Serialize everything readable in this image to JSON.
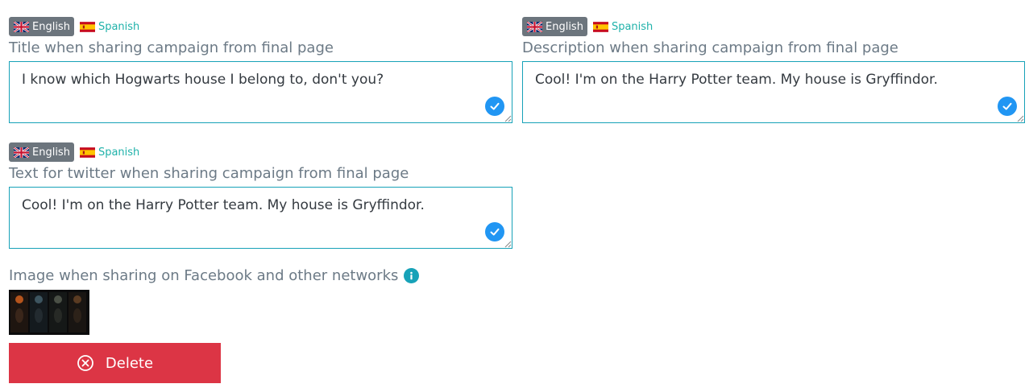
{
  "fields": [
    {
      "lang_active": "English",
      "lang_inactive": "Spanish",
      "label": "Title when sharing campaign from final page",
      "value": "I know which Hogwarts house I belong to, don't you?"
    },
    {
      "lang_active": "English",
      "lang_inactive": "Spanish",
      "label": "Description when sharing campaign from final page",
      "value": "Cool! I'm on the Harry Potter team. My house is Gryffindor."
    },
    {
      "lang_active": "English",
      "lang_inactive": "Spanish",
      "label": "Text for twitter when sharing campaign from final page",
      "value": "Cool! I'm on the Harry Potter team. My house is Gryffindor."
    }
  ],
  "image_section": {
    "label": "Image when sharing on Facebook and other networks",
    "info_icon": "info-circle-icon"
  },
  "delete_button": {
    "label": "Delete",
    "icon": "x-circle-icon"
  },
  "colors": {
    "active_lang_bg": "#6c757d",
    "inactive_lang_text": "#20b2aa",
    "textarea_border": "#17a2b8",
    "check_bg": "#2196f3",
    "delete_bg": "#dc3545"
  }
}
